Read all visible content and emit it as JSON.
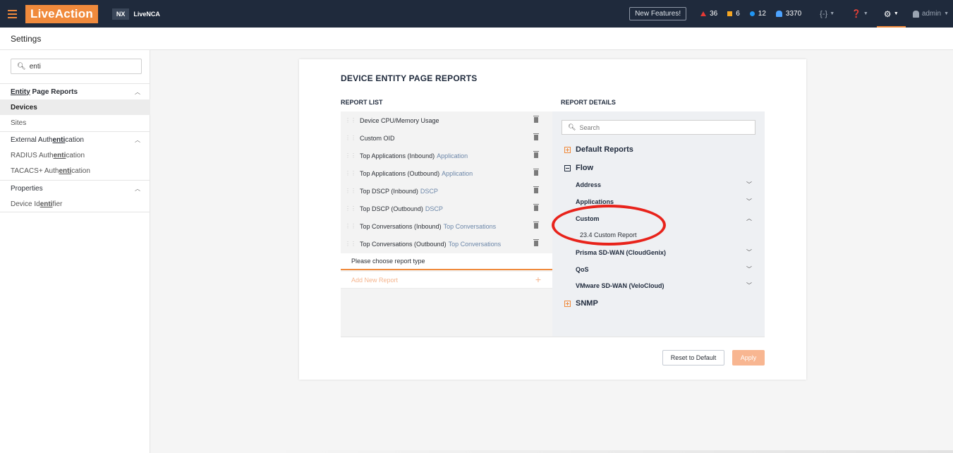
{
  "topbar": {
    "logo": "LiveAction",
    "nx_badge": "NX",
    "product": "LiveNCA",
    "new_features": "New Features!",
    "alerts": [
      {
        "kind": "critical",
        "count": "36",
        "color": "#e53935"
      },
      {
        "kind": "warning",
        "count": "6",
        "color": "#f5a623"
      },
      {
        "kind": "info",
        "count": "12",
        "color": "#2196f3"
      }
    ],
    "notifications": "3370",
    "code_menu": "{-}",
    "help_icon": "question-icon",
    "settings_icon": "gear-icon",
    "user": "admin"
  },
  "settings": {
    "title": "Settings"
  },
  "sidebar": {
    "search_value": "enti",
    "groups": [
      {
        "title_parts": [
          "Entity",
          " Page Reports"
        ],
        "items": [
          "Devices",
          "Sites"
        ]
      },
      {
        "title_parts": [
          "External Auth",
          "enti",
          "cation"
        ],
        "items_parts": [
          [
            "RADIUS Auth",
            "enti",
            "cation"
          ],
          [
            "TACACS+ Auth",
            "enti",
            "cation"
          ]
        ]
      },
      {
        "title": "Properties",
        "items_parts": [
          [
            "Device Id",
            "enti",
            "fier"
          ]
        ]
      }
    ]
  },
  "card": {
    "title": "DEVICE ENTITY PAGE REPORTS",
    "report_list_header": "REPORT LIST",
    "report_details_header": "REPORT DETAILS",
    "reports": [
      {
        "name": "Device CPU/Memory Usage",
        "sub": ""
      },
      {
        "name": "Custom OID",
        "sub": ""
      },
      {
        "name": "Top Applications (Inbound)",
        "sub": "Application"
      },
      {
        "name": "Top Applications (Outbound)",
        "sub": "Application"
      },
      {
        "name": "Top DSCP (Inbound)",
        "sub": "DSCP"
      },
      {
        "name": "Top DSCP (Outbound)",
        "sub": "DSCP"
      },
      {
        "name": "Top Conversations (Inbound)",
        "sub": "Top Conversations"
      },
      {
        "name": "Top Conversations (Outbound)",
        "sub": "Top Conversations"
      }
    ],
    "choose_placeholder": "Please choose report type",
    "add_new": "Add New Report",
    "details_search_placeholder": "Search",
    "tree": {
      "default_reports": "Default Reports",
      "flow": "Flow",
      "flow_children": [
        "Address",
        "Applications",
        "Custom",
        "Prisma SD-WAN (CloudGenix)",
        "QoS",
        "VMware SD-WAN (VeloCloud)"
      ],
      "custom_leaf": "23.4 Custom Report",
      "snmp": "SNMP"
    },
    "reset_button": "Reset to Default",
    "apply_button": "Apply",
    "accent_color": "#f08a3c",
    "highlight_color": "#e8231b"
  }
}
